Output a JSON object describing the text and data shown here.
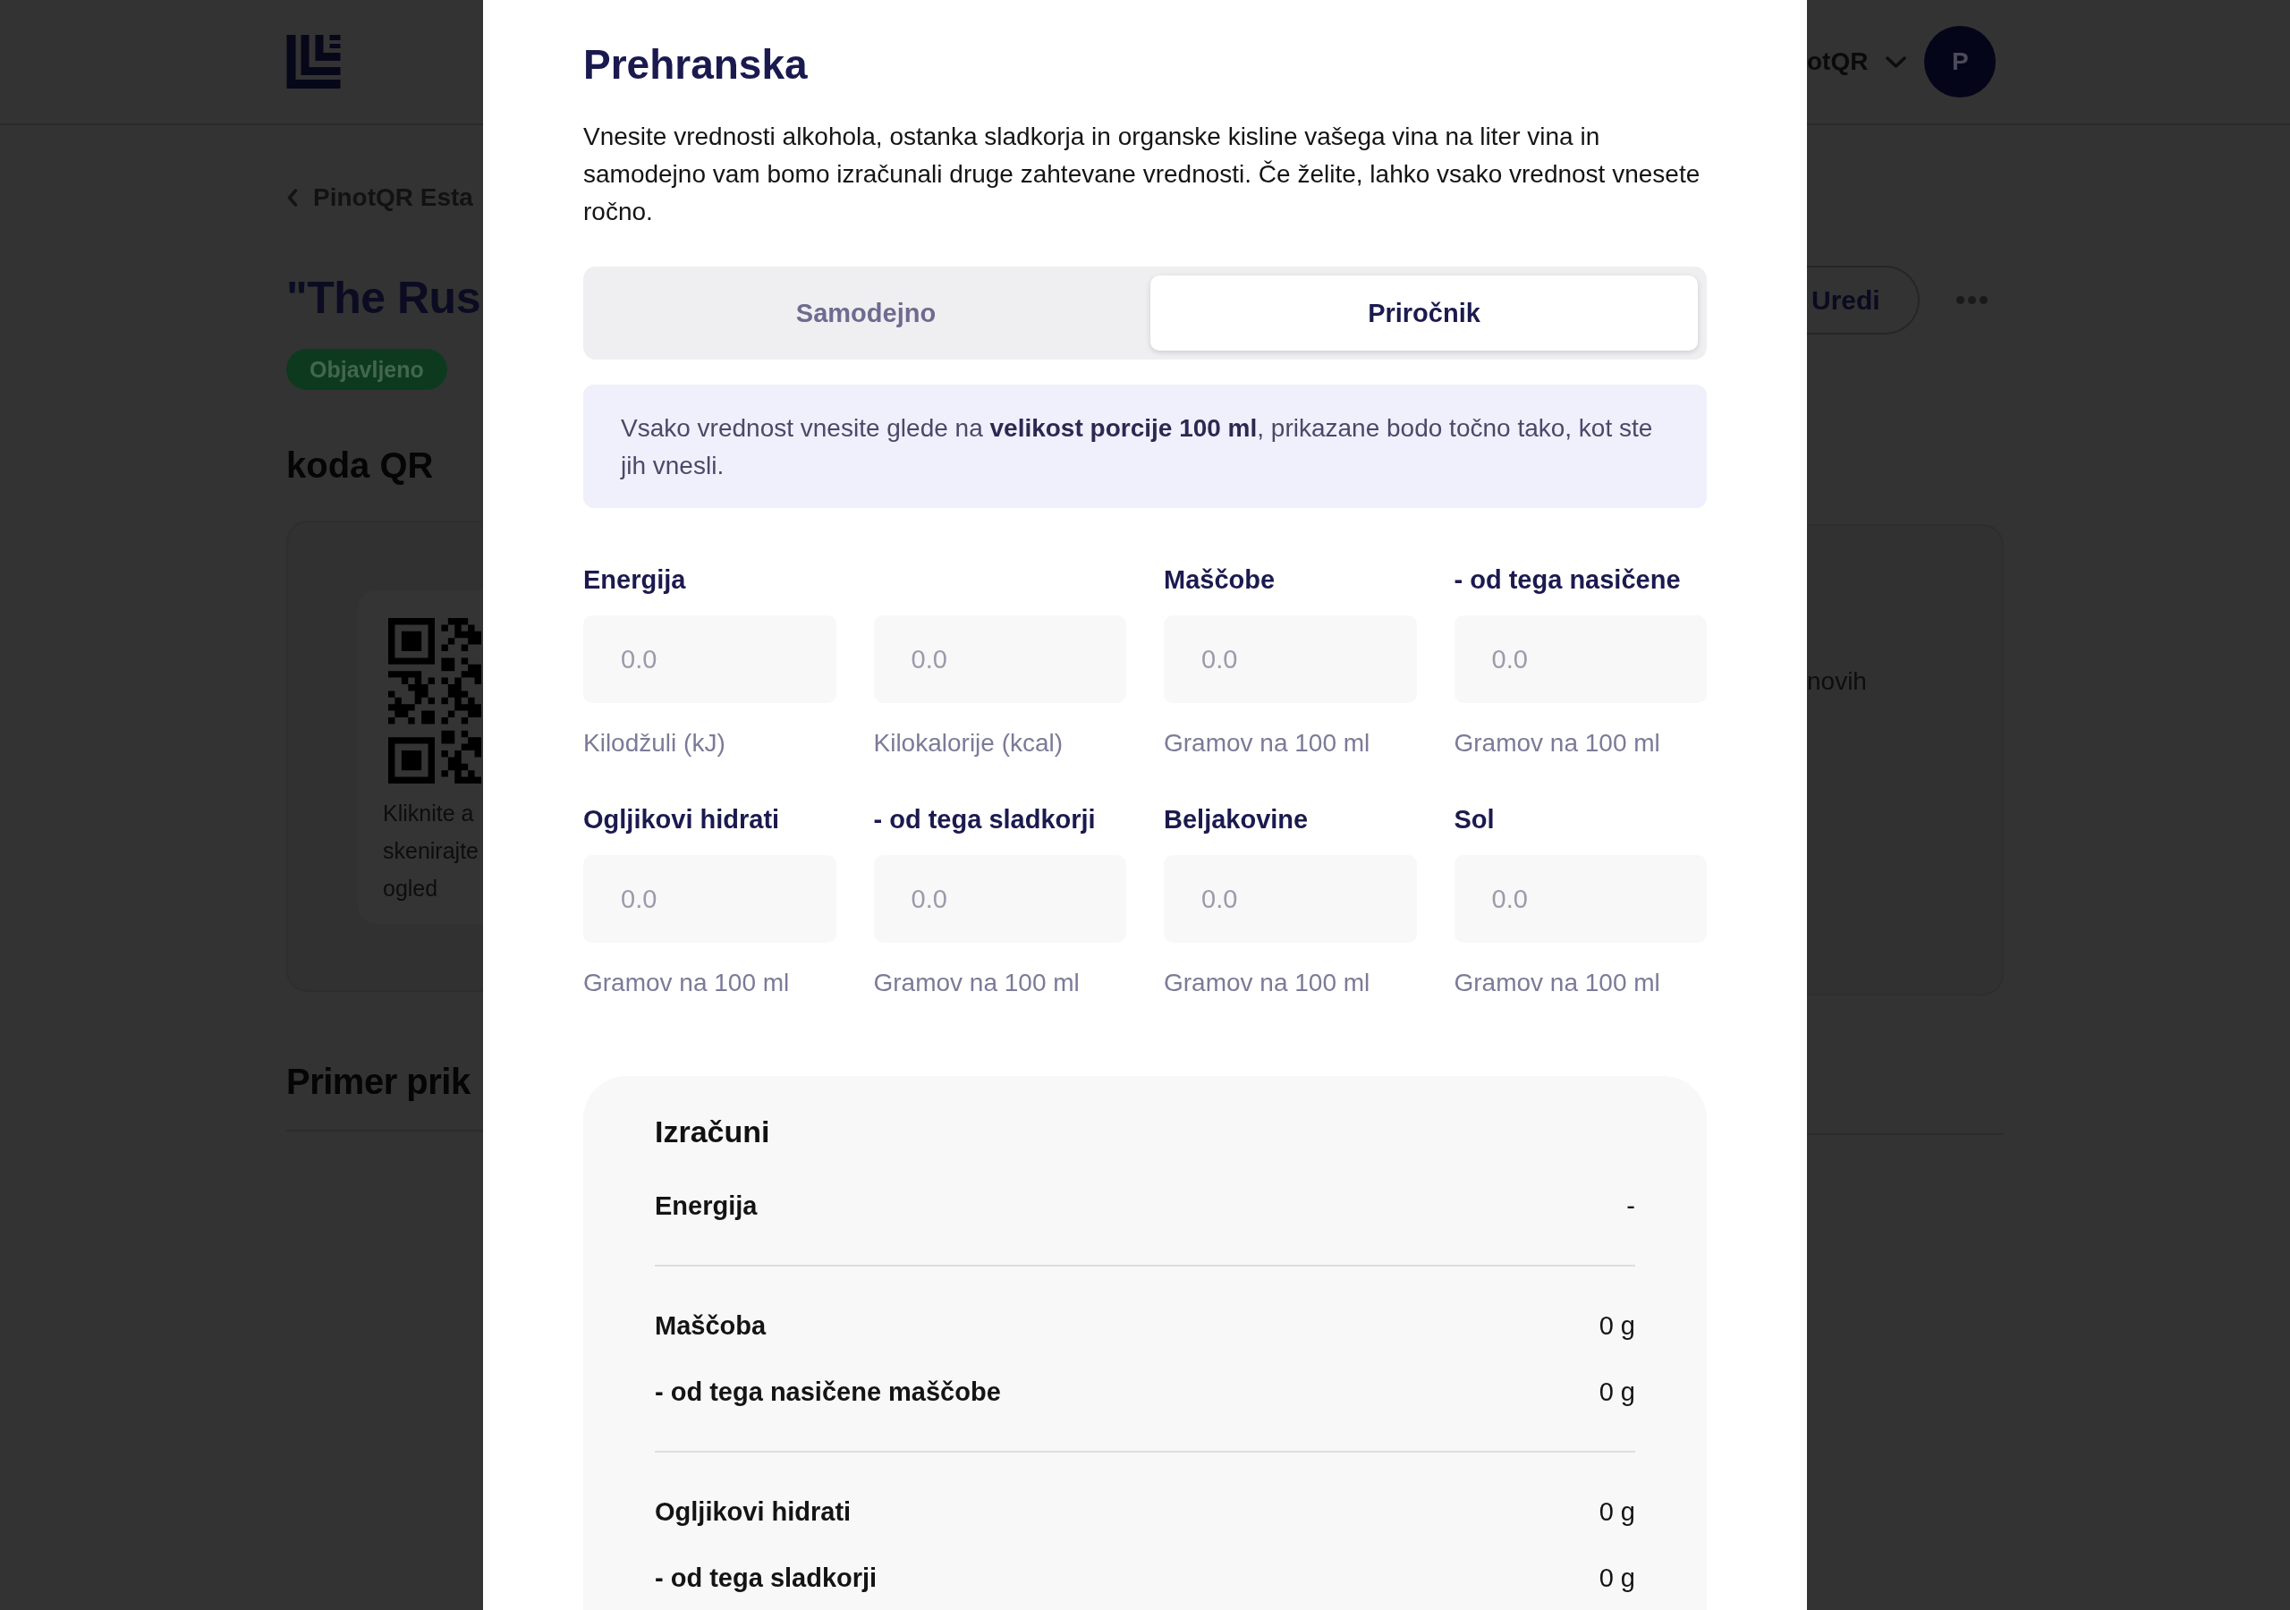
{
  "background_page": {
    "header": {
      "account_name": "otQR",
      "avatar_initial": "P"
    },
    "breadcrumb": "PinotQR Esta",
    "title": "\"The Rus",
    "status_badge": "Objavljeno",
    "edit_button": "Uredi",
    "qr_section": {
      "heading": "koda QR",
      "hint_lines": [
        "Kliknite a",
        "skenirajte",
        "ogled"
      ],
      "side_text": "novih"
    },
    "preview_heading": "Primer prik"
  },
  "modal": {
    "title": "Prehranska",
    "description": "Vnesite vrednosti alkohola, ostanka sladkorja in organske kisline vašega vina na liter vina in samodejno vam bomo izračunali druge zahtevane vrednosti. Če želite, lahko vsako vrednost vnesete ročno.",
    "mode_tabs": [
      {
        "label": "Samodejno",
        "selected": false
      },
      {
        "label": "Priročnik",
        "selected": true
      }
    ],
    "notice": "Vsako vrednost vnesite glede na **velikost porcije 100 ml**, prikazane bodo točno tako, kot ste jih vnesli.",
    "fields": [
      {
        "label": "Energija",
        "placeholder": "0.0",
        "unit": "Kilodžuli (kJ)"
      },
      {
        "placeholder": "0.0",
        "unit": "Kilokalorije (kcal)"
      },
      {
        "label": "Maščobe",
        "placeholder": "0.0",
        "unit": "Gramov na 100 ml"
      },
      {
        "label": "- od tega nasičene",
        "placeholder": "0.0",
        "unit": "Gramov na 100 ml"
      },
      {
        "label": "Ogljikovi hidrati",
        "placeholder": "0.0",
        "unit": "Gramov na 100 ml"
      },
      {
        "label": "- od tega sladkorji",
        "placeholder": "0.0",
        "unit": "Gramov na 100 ml"
      },
      {
        "label": "Beljakovine",
        "placeholder": "0.0",
        "unit": "Gramov na 100 ml"
      },
      {
        "label": "Sol",
        "placeholder": "0.0",
        "unit": "Gramov na 100 ml"
      }
    ],
    "calculations": {
      "title": "Izračuni",
      "groups": [
        {
          "rows": [
            {
              "name": "Energija",
              "value": "-"
            }
          ]
        },
        {
          "rows": [
            {
              "name": "Maščoba",
              "value": "0 g"
            },
            {
              "name": "- od tega nasičene maščobe",
              "value": "0 g"
            }
          ]
        },
        {
          "rows": [
            {
              "name": "Ogljikovi hidrati",
              "value": "0 g"
            },
            {
              "name": "- od tega sladkorji",
              "value": "0 g"
            }
          ]
        }
      ]
    }
  }
}
